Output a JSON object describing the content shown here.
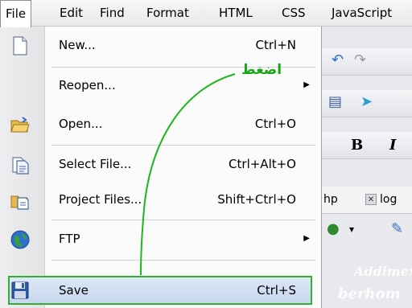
{
  "menubar": {
    "items": [
      "File",
      "Edit",
      "Find",
      "Format",
      "HTML",
      "CSS",
      "JavaScript"
    ],
    "active": "File"
  },
  "file_menu": {
    "items": [
      {
        "label": "New...",
        "shortcut": "Ctrl+N",
        "icon": "new-document-icon"
      },
      {
        "label": "Reopen...",
        "shortcut": "",
        "icon": "",
        "submenu": true
      },
      {
        "label": "Open...",
        "shortcut": "Ctrl+O",
        "icon": "open-folder-icon"
      },
      {
        "label": "Select File...",
        "shortcut": "Ctrl+Alt+O",
        "icon": "select-file-icon"
      },
      {
        "label": "Project Files...",
        "shortcut": "Shift+Ctrl+O",
        "icon": "project-files-icon"
      },
      {
        "label": "FTP",
        "shortcut": "",
        "icon": "globe-icon",
        "submenu": true
      },
      {
        "label": "Save",
        "shortcut": "Ctrl+S",
        "icon": "floppy-disk-icon",
        "highlighted": true
      }
    ]
  },
  "annotation": {
    "text": "اضغط",
    "color": "#17a417"
  },
  "background": {
    "tab_fragment_1": "hp",
    "tab_fragment_2": "log",
    "bold": "B",
    "italic": "I",
    "watermark_1": "Addimex",
    "watermark_2": "berhom"
  },
  "colors": {
    "highlight_outline": "#33b033",
    "highlight_fill": "#c5d6ee"
  }
}
